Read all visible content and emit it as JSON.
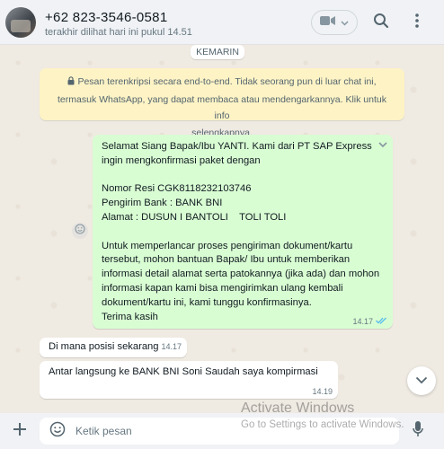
{
  "header": {
    "contact_name": "+62 823-3546-0581",
    "last_seen": "terakhir dilihat hari ini pukul 14.51",
    "icons": [
      "video-call-icon",
      "chevron-down-icon",
      "search-icon",
      "menu-icon"
    ]
  },
  "chat": {
    "date_chip": "KEMARIN",
    "encryption_notice": {
      "line1": "Pesan terenkripsi secara end-to-end. Tidak seorang pun di luar chat ini,",
      "line2": "termasuk WhatsApp, yang dapat membaca atau mendengarkannya. Klik untuk info",
      "line3": "selengkapnya."
    },
    "messages": [
      {
        "direction": "outgoing",
        "lines": [
          "Selamat Siang Bapak/Ibu YANTI. Kami dari PT SAP Express",
          "ingin mengkonfirmasi paket dengan",
          "",
          "Nomor Resi CGK8118232103746",
          "Pengirim Bank : BANK BNI",
          "Alamat : DUSUN I BANTOLI    TOLI TOLI",
          "",
          "Untuk memperlancar proses pengiriman dokument/kartu",
          "tersebut, mohon bantuan Bapak/ Ibu untuk memberikan",
          "informasi detail alamat serta patokannya (jika ada) dan mohon",
          "informasi kapan kami bisa mengirimkan ulang kembali",
          "dokument/kartu ini, kami tunggu konfirmasinya.",
          "Terima kasih"
        ],
        "time": "14.17",
        "status": "read"
      },
      {
        "direction": "incoming",
        "text": "Di mana posisi sekarang",
        "time": "14.17"
      },
      {
        "direction": "incoming",
        "text": "Antar langsung ke BANK BNI Soni Saudah saya kompirmasi",
        "time": "14.19"
      }
    ]
  },
  "composer": {
    "placeholder": "Ketik pesan"
  },
  "watermark": {
    "line1": "Activate Windows",
    "line2": "Go to Settings to activate Windows."
  },
  "colors": {
    "header_bg": "#f0f2f5",
    "chat_bg": "#efeae2",
    "outgoing_bubble": "#d9fdd3",
    "incoming_bubble": "#ffffff",
    "notice_bg": "#fdf3c5",
    "read_tick": "#53bdeb"
  }
}
